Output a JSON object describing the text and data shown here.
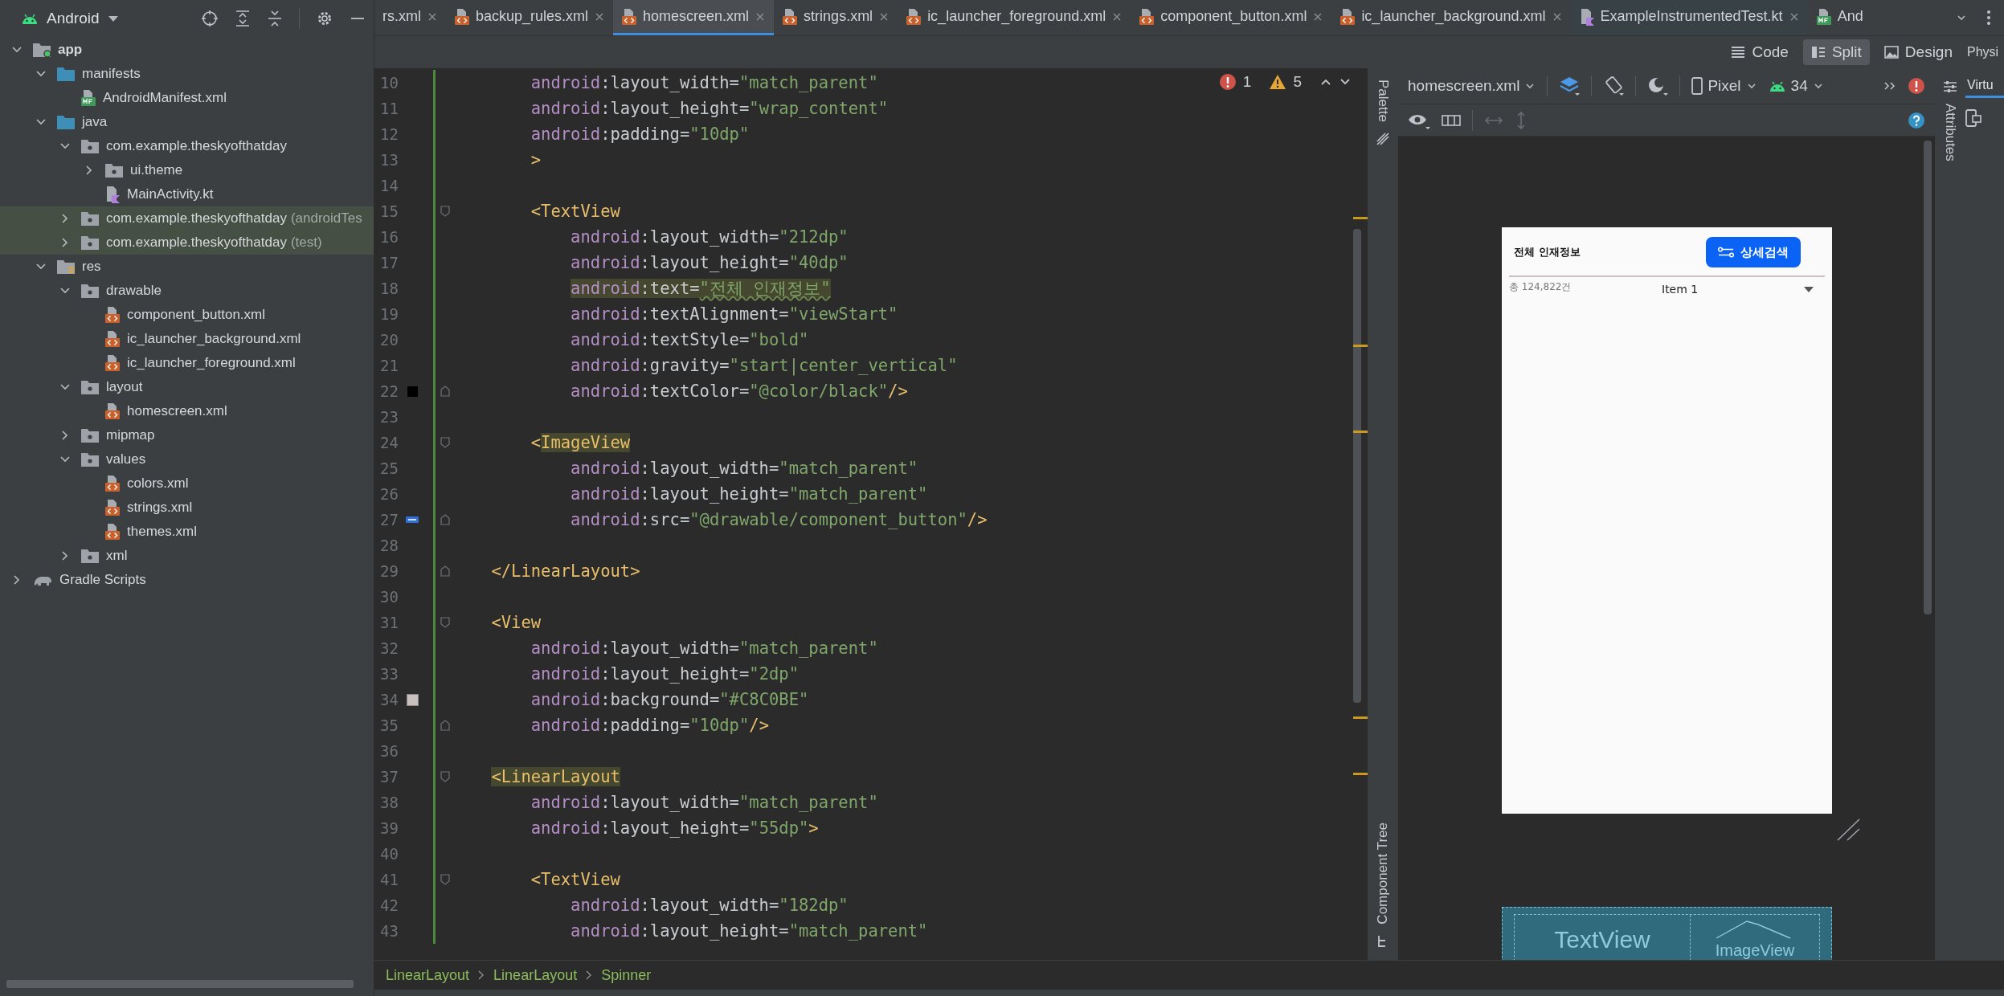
{
  "project_panel": {
    "view": "Android",
    "tree": [
      {
        "label": "app",
        "kind": "module",
        "expanded": true,
        "children": [
          {
            "label": "manifests",
            "kind": "source-folder",
            "expanded": true,
            "children": [
              {
                "label": "AndroidManifest.xml",
                "kind": "manifest"
              }
            ]
          },
          {
            "label": "java",
            "kind": "source-folder",
            "expanded": true,
            "children": [
              {
                "label": "com.example.theskyofthatday",
                "kind": "package",
                "expanded": true,
                "children": [
                  {
                    "label": "ui.theme",
                    "kind": "package",
                    "expanded": false
                  },
                  {
                    "label": "MainActivity.kt",
                    "kind": "kotlin"
                  }
                ]
              },
              {
                "label": "com.example.theskyofthatday",
                "suffix": "(androidTes",
                "kind": "package",
                "expanded": false,
                "test_root": true
              },
              {
                "label": "com.example.theskyofthatday",
                "suffix": "(test)",
                "kind": "package",
                "expanded": false,
                "test_root": true
              }
            ]
          },
          {
            "label": "res",
            "kind": "res",
            "expanded": true,
            "children": [
              {
                "label": "drawable",
                "kind": "package",
                "expanded": true,
                "children": [
                  {
                    "label": "component_button.xml",
                    "kind": "xml"
                  },
                  {
                    "label": "ic_launcher_background.xml",
                    "kind": "xml"
                  },
                  {
                    "label": "ic_launcher_foreground.xml",
                    "kind": "xml"
                  }
                ]
              },
              {
                "label": "layout",
                "kind": "package",
                "expanded": true,
                "children": [
                  {
                    "label": "homescreen.xml",
                    "kind": "xml"
                  }
                ]
              },
              {
                "label": "mipmap",
                "kind": "package",
                "expanded": false
              },
              {
                "label": "values",
                "kind": "package",
                "expanded": true,
                "children": [
                  {
                    "label": "colors.xml",
                    "kind": "xml"
                  },
                  {
                    "label": "strings.xml",
                    "kind": "xml"
                  },
                  {
                    "label": "themes.xml",
                    "kind": "xml"
                  }
                ]
              },
              {
                "label": "xml",
                "kind": "package",
                "expanded": false
              }
            ]
          }
        ]
      },
      {
        "label": "Gradle Scripts",
        "kind": "gradle",
        "expanded": false
      }
    ]
  },
  "tabs": [
    {
      "label": "rs.xml",
      "kind": "plain",
      "selected": false
    },
    {
      "label": "backup_rules.xml",
      "kind": "xml",
      "selected": false
    },
    {
      "label": "homescreen.xml",
      "kind": "xml",
      "selected": true
    },
    {
      "label": "strings.xml",
      "kind": "xml",
      "selected": false
    },
    {
      "label": "ic_launcher_foreground.xml",
      "kind": "xml",
      "selected": false
    },
    {
      "label": "component_button.xml",
      "kind": "xml",
      "selected": false
    },
    {
      "label": "ic_launcher_background.xml",
      "kind": "xml",
      "selected": false
    },
    {
      "label": "ExampleInstrumentedTest.kt",
      "kind": "kotlin",
      "selected": false
    },
    {
      "label": "And",
      "kind": "manifest",
      "selected": false
    }
  ],
  "view_modes": [
    {
      "label": "Code",
      "kind": "code",
      "selected": false
    },
    {
      "label": "Split",
      "kind": "split",
      "selected": true
    },
    {
      "label": "Design",
      "kind": "design",
      "selected": false
    }
  ],
  "side_tab": "Physi",
  "editor": {
    "errors": "1",
    "warnings": "5",
    "lines": [
      {
        "n": "10",
        "parts": [
          {
            "kind": "ns",
            "text": "        android"
          },
          {
            "kind": "attr",
            "text": ":layout_width="
          },
          {
            "kind": "str",
            "text": "\"match_parent\""
          }
        ]
      },
      {
        "n": "11",
        "parts": [
          {
            "kind": "ns",
            "text": "        android"
          },
          {
            "kind": "attr",
            "text": ":layout_height="
          },
          {
            "kind": "str",
            "text": "\"wrap_content\""
          }
        ]
      },
      {
        "n": "12",
        "parts": [
          {
            "kind": "ns",
            "text": "        android"
          },
          {
            "kind": "attr",
            "text": ":padding="
          },
          {
            "kind": "str",
            "text": "\"10dp\""
          }
        ]
      },
      {
        "n": "13",
        "parts": [
          {
            "kind": "tag",
            "text": "        >"
          }
        ]
      },
      {
        "n": "14"
      },
      {
        "n": "15",
        "fold": {
          "kind": "start"
        },
        "parts": [
          {
            "kind": "tag",
            "text": "        <TextView"
          }
        ]
      },
      {
        "n": "16",
        "parts": [
          {
            "kind": "ns",
            "text": "            android"
          },
          {
            "kind": "attr",
            "text": ":layout_width="
          },
          {
            "kind": "str",
            "text": "\"212dp\""
          }
        ]
      },
      {
        "n": "17",
        "parts": [
          {
            "kind": "ns",
            "text": "            android"
          },
          {
            "kind": "attr",
            "text": ":layout_height="
          },
          {
            "kind": "str",
            "text": "\"40dp\""
          }
        ]
      },
      {
        "n": "18",
        "parts": [
          {
            "kind": "ns",
            "text": "            android",
            "highlight": true
          },
          {
            "kind": "attr",
            "text": ":text=",
            "highlight": true
          },
          {
            "kind": "str",
            "text": "\"전체 인재정보\"",
            "highlight": true,
            "typo": true
          }
        ]
      },
      {
        "n": "19",
        "parts": [
          {
            "kind": "ns",
            "text": "            android"
          },
          {
            "kind": "attr",
            "text": ":textAlignment="
          },
          {
            "kind": "str",
            "text": "\"viewStart\""
          }
        ]
      },
      {
        "n": "20",
        "parts": [
          {
            "kind": "ns",
            "text": "            android"
          },
          {
            "kind": "attr",
            "text": ":textStyle="
          },
          {
            "kind": "str",
            "text": "\"bold\""
          }
        ]
      },
      {
        "n": "21",
        "parts": [
          {
            "kind": "ns",
            "text": "            android"
          },
          {
            "kind": "attr",
            "text": ":gravity="
          },
          {
            "kind": "str",
            "text": "\"start|center_vertical\""
          }
        ]
      },
      {
        "n": "22",
        "fold": {
          "kind": "end"
        },
        "gutter": {
          "kind": "swatch",
          "color": "#000000"
        },
        "parts": [
          {
            "kind": "ns",
            "text": "            android"
          },
          {
            "kind": "attr",
            "text": ":textColor="
          },
          {
            "kind": "str",
            "text": "\"@color/black\""
          },
          {
            "kind": "tag",
            "text": "/>"
          }
        ]
      },
      {
        "n": "23"
      },
      {
        "n": "24",
        "fold": {
          "kind": "start"
        },
        "parts": [
          {
            "kind": "tag",
            "text": "        <"
          },
          {
            "kind": "tag",
            "text": "ImageView",
            "highlight": true
          }
        ]
      },
      {
        "n": "25",
        "parts": [
          {
            "kind": "ns",
            "text": "            android"
          },
          {
            "kind": "attr",
            "text": ":layout_width="
          },
          {
            "kind": "str",
            "text": "\"match_parent\""
          }
        ]
      },
      {
        "n": "26",
        "parts": [
          {
            "kind": "ns",
            "text": "            android"
          },
          {
            "kind": "attr",
            "text": ":layout_height="
          },
          {
            "kind": "str",
            "text": "\"match_parent\""
          }
        ]
      },
      {
        "n": "27",
        "fold": {
          "kind": "end"
        },
        "gutter": {
          "kind": "image"
        },
        "parts": [
          {
            "kind": "ns",
            "text": "            android"
          },
          {
            "kind": "attr",
            "text": ":src="
          },
          {
            "kind": "str",
            "text": "\"@drawable/component_button\""
          },
          {
            "kind": "tag",
            "text": "/>"
          }
        ]
      },
      {
        "n": "28"
      },
      {
        "n": "29",
        "fold": {
          "kind": "end"
        },
        "parts": [
          {
            "kind": "tag",
            "text": "    </LinearLayout>"
          }
        ]
      },
      {
        "n": "30"
      },
      {
        "n": "31",
        "fold": {
          "kind": "start"
        },
        "parts": [
          {
            "kind": "tag",
            "text": "    <View"
          }
        ]
      },
      {
        "n": "32",
        "parts": [
          {
            "kind": "ns",
            "text": "        android"
          },
          {
            "kind": "attr",
            "text": ":layout_width="
          },
          {
            "kind": "str",
            "text": "\"match_parent\""
          }
        ]
      },
      {
        "n": "33",
        "parts": [
          {
            "kind": "ns",
            "text": "        android"
          },
          {
            "kind": "attr",
            "text": ":layout_height="
          },
          {
            "kind": "str",
            "text": "\"2dp\""
          }
        ]
      },
      {
        "n": "34",
        "gutter": {
          "kind": "swatch",
          "color": "#c8c0be"
        },
        "parts": [
          {
            "kind": "ns",
            "text": "        android"
          },
          {
            "kind": "attr",
            "text": ":background="
          },
          {
            "kind": "str",
            "text": "\"#C8C0BE\""
          }
        ]
      },
      {
        "n": "35",
        "fold": {
          "kind": "end"
        },
        "parts": [
          {
            "kind": "ns",
            "text": "        android"
          },
          {
            "kind": "attr",
            "text": ":padding="
          },
          {
            "kind": "str",
            "text": "\"10dp\""
          },
          {
            "kind": "tag",
            "text": "/>"
          }
        ]
      },
      {
        "n": "36"
      },
      {
        "n": "37",
        "fold": {
          "kind": "start"
        },
        "parts": [
          {
            "kind": "tag",
            "text": "    <LinearLayout",
            "highlight": true
          }
        ]
      },
      {
        "n": "38",
        "parts": [
          {
            "kind": "ns",
            "text": "        android"
          },
          {
            "kind": "attr",
            "text": ":layout_width="
          },
          {
            "kind": "str",
            "text": "\"match_parent\""
          }
        ]
      },
      {
        "n": "39",
        "parts": [
          {
            "kind": "ns",
            "text": "        android"
          },
          {
            "kind": "attr",
            "text": ":layout_height="
          },
          {
            "kind": "str",
            "text": "\"55dp\""
          },
          {
            "kind": "tag",
            "text": ">"
          }
        ]
      },
      {
        "n": "40"
      },
      {
        "n": "41",
        "fold": {
          "kind": "start"
        },
        "parts": [
          {
            "kind": "tag",
            "text": "        <TextView"
          }
        ]
      },
      {
        "n": "42",
        "parts": [
          {
            "kind": "ns",
            "text": "            android"
          },
          {
            "kind": "attr",
            "text": ":layout_width="
          },
          {
            "kind": "str",
            "text": "\"182dp\""
          }
        ]
      },
      {
        "n": "43",
        "parts": [
          {
            "kind": "ns",
            "text": "            android"
          },
          {
            "kind": "attr",
            "text": ":layout_height="
          },
          {
            "kind": "str",
            "text": "\"match_parent\""
          }
        ]
      }
    ]
  },
  "breadcrumbs": [
    "LinearLayout",
    "LinearLayout",
    "Spinner"
  ],
  "design": {
    "palette_label": "Palette",
    "component_tree_label": "Component Tree",
    "file": "homescreen.xml",
    "device": "Pixel",
    "api": "34",
    "preview": {
      "title": "전체 인재정보",
      "button": "상세검색",
      "count": "총 124,822건",
      "spinner": "Item 1"
    },
    "blueprint": [
      "TextView",
      "ImageView"
    ]
  },
  "attributes_label": "Attributes",
  "running_devices": {
    "label": "Virtu"
  }
}
